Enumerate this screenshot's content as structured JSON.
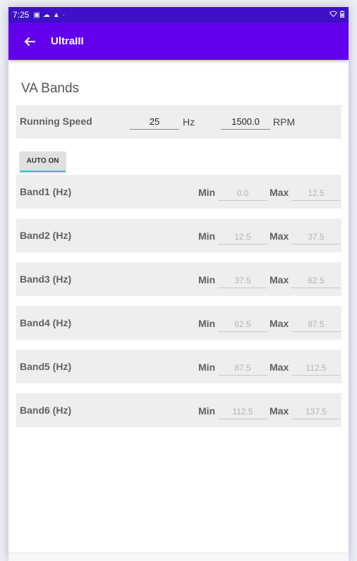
{
  "status_bar": {
    "time": "7:25"
  },
  "app_bar": {
    "title": "UltraIII"
  },
  "section": {
    "title": "VA Bands"
  },
  "running_speed": {
    "label": "Running Speed",
    "hz_value": "25",
    "hz_unit": "Hz",
    "rpm_value": "1500.0",
    "rpm_unit": "RPM"
  },
  "auto_button": {
    "label": "AUTO ON"
  },
  "band_labels": {
    "min": "Min",
    "max": "Max"
  },
  "bands": [
    {
      "label": "Band1 (Hz)",
      "min": "0.0",
      "max": "12.5"
    },
    {
      "label": "Band2 (Hz)",
      "min": "12.5",
      "max": "37.5"
    },
    {
      "label": "Band3 (Hz)",
      "min": "37.5",
      "max": "62.5"
    },
    {
      "label": "Band4 (Hz)",
      "min": "62.5",
      "max": "87.5"
    },
    {
      "label": "Band5 (Hz)",
      "min": "87.5",
      "max": "112.5"
    },
    {
      "label": "Band6 (Hz)",
      "min": "112.5",
      "max": "137.5"
    }
  ],
  "colors": {
    "status_bar": "#3e10c7",
    "app_bar": "#6200ee",
    "row_bg": "#eeeeee",
    "accent_underline": "#26c6da"
  }
}
